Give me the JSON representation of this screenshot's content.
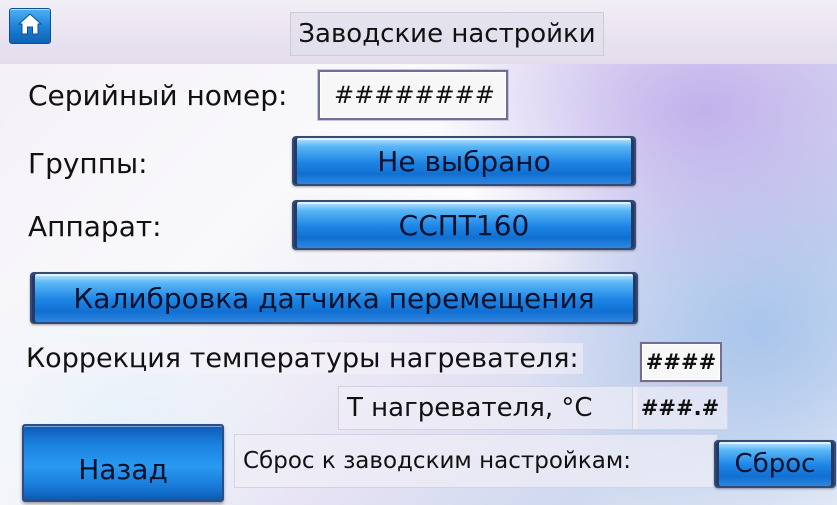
{
  "header": {
    "home_icon": "home-icon",
    "title": "Заводские настройки"
  },
  "serial": {
    "label": "Серийный номер:",
    "value": "########"
  },
  "groups": {
    "label": "Группы:",
    "value": "Не выбрано"
  },
  "device": {
    "label": "Аппарат:",
    "value": "ССПТ160"
  },
  "calibration": {
    "button_label": "Калибровка датчика перемещения"
  },
  "temp_correction": {
    "label": "Коррекция температуры нагревателя:",
    "value": "####"
  },
  "heater_temp": {
    "label": "Т нагревателя, °С",
    "value": "###.#"
  },
  "footer": {
    "back_label": "Назад",
    "reset_label": "Сброс к заводским настройкам:",
    "reset_button": "Сброс"
  },
  "colors": {
    "button_blue": "#1f86e6",
    "button_border": "#314a78",
    "field_border": "#6f6f96"
  }
}
